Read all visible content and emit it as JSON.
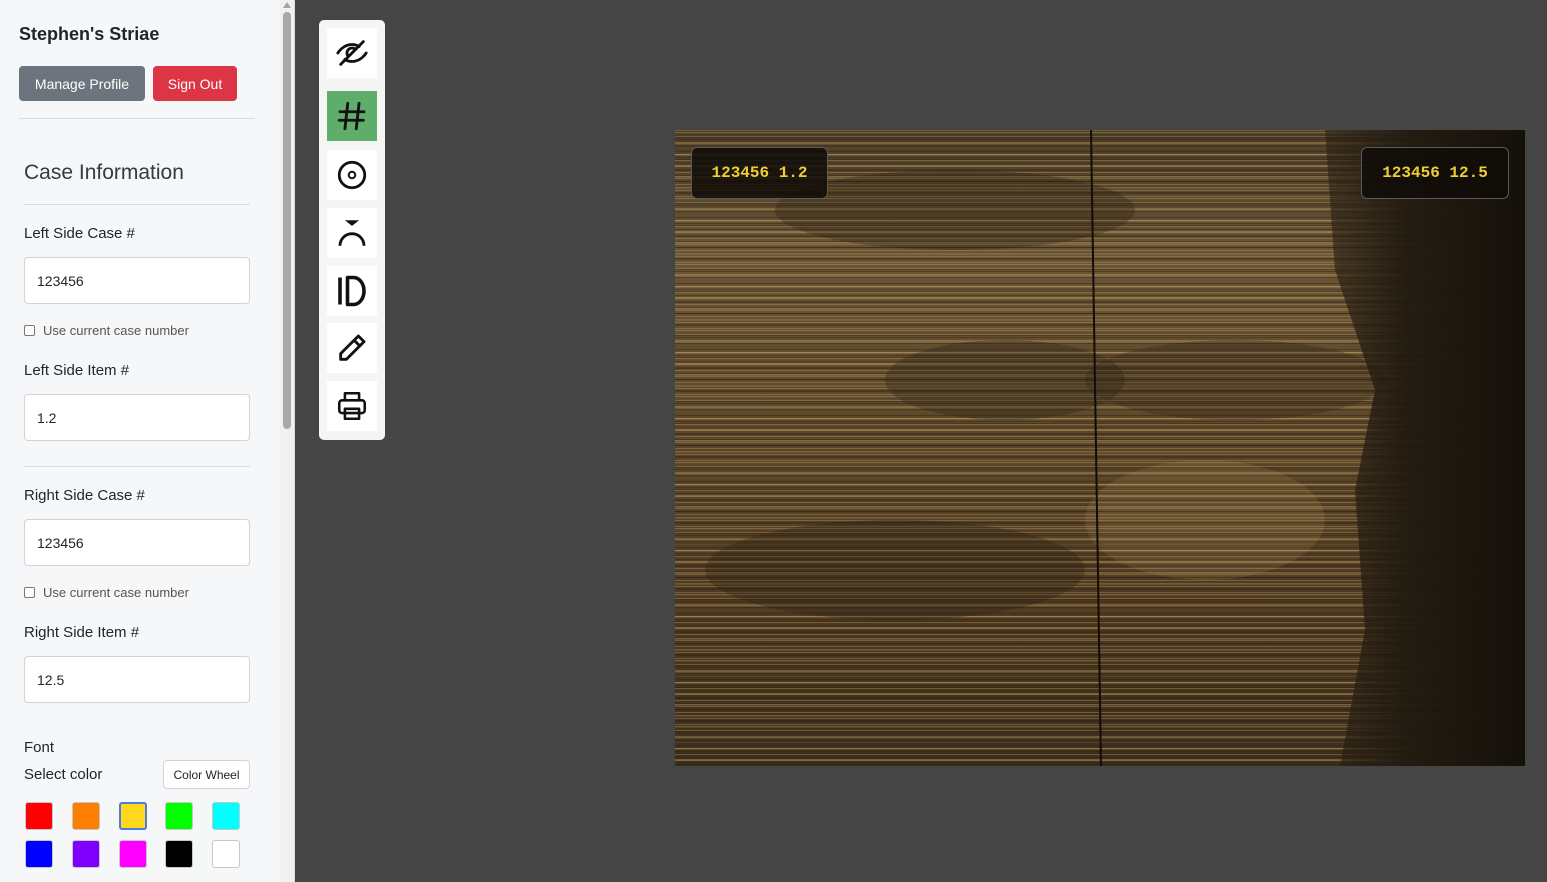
{
  "sidebar": {
    "user_name": "Stephen's Striae",
    "manage_profile_label": "Manage Profile",
    "sign_out_label": "Sign Out",
    "section_title": "Case Information",
    "left_case_label": "Left Side Case #",
    "left_case_value": "123456",
    "left_use_current_label": "Use current case number",
    "left_use_current_checked": false,
    "left_item_label": "Left Side Item #",
    "left_item_value": "1.2",
    "right_case_label": "Right Side Case #",
    "right_case_value": "123456",
    "right_use_current_label": "Use current case number",
    "right_use_current_checked": false,
    "right_item_label": "Right Side Item #",
    "right_item_value": "12.5",
    "font_label": "Font",
    "select_color_label": "Select color",
    "color_wheel_label": "Color Wheel",
    "selected_color": "#ffd81c",
    "swatches": [
      "#ff0000",
      "#ff8000",
      "#ffd81c",
      "#00ff00",
      "#00ffff",
      "#0000ff",
      "#8000ff",
      "#ff00ff",
      "#000000",
      "#ffffff"
    ]
  },
  "toolbar": {
    "tools": [
      {
        "icon": "eye-off-icon",
        "active": false
      },
      {
        "icon": "hash-icon",
        "active": true
      },
      {
        "icon": "target-icon",
        "active": false
      },
      {
        "icon": "index-arc-icon",
        "active": false
      },
      {
        "icon": "id-icon",
        "active": false
      },
      {
        "icon": "pencil-icon",
        "active": false
      },
      {
        "icon": "printer-icon",
        "active": false
      }
    ],
    "active_color": "#5fad6a"
  },
  "viewer": {
    "left_label": "123456 1.2",
    "right_label": "123456 12.5",
    "label_color": "#f0cf30"
  }
}
